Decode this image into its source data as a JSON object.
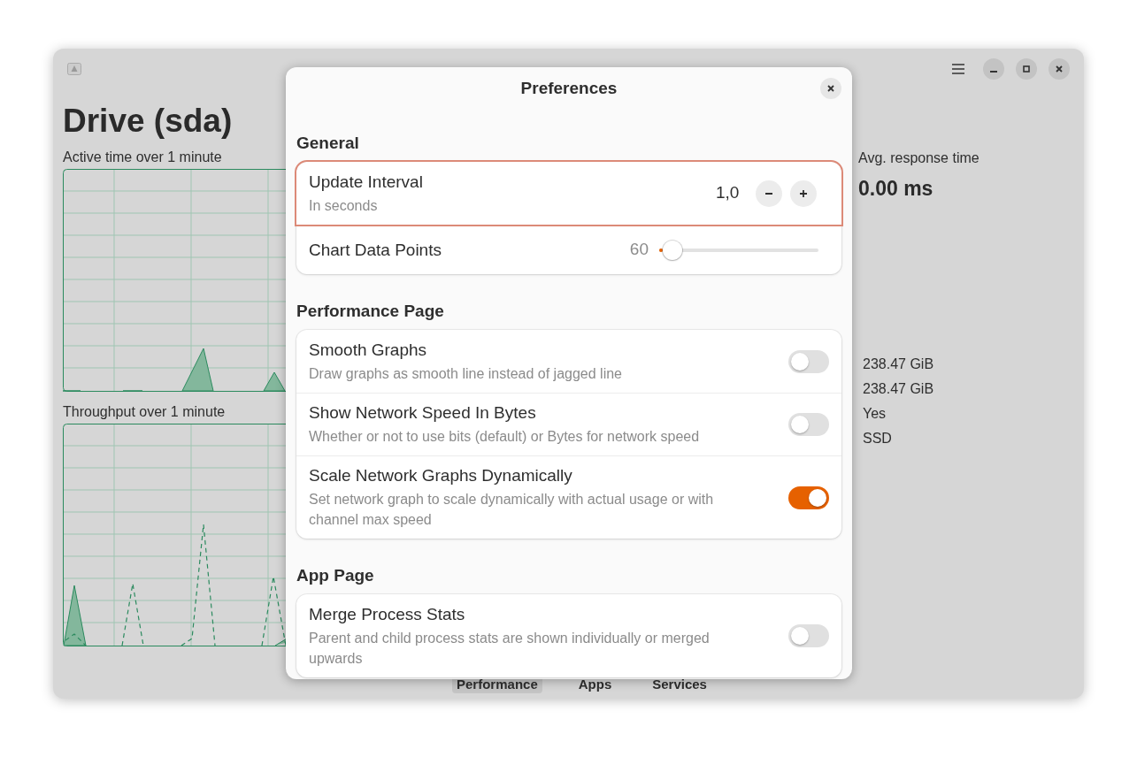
{
  "window": {
    "title": "Drive (sda)",
    "charts": [
      {
        "title": "Active time over 1 minute",
        "kind": "single"
      },
      {
        "title": "Throughput over 1 minute",
        "kind": "dual"
      }
    ],
    "stats": [
      {
        "label": "Avg. response time",
        "value": "0.00 ms"
      }
    ],
    "details": [
      "238.47 GiB",
      "238.47 GiB",
      "Yes",
      "SSD"
    ],
    "tabs": [
      {
        "label": "Performance",
        "selected": true
      },
      {
        "label": "Apps",
        "selected": false
      },
      {
        "label": "Services",
        "selected": false
      }
    ]
  },
  "dialog": {
    "title": "Preferences",
    "sections": [
      {
        "heading": "General",
        "rows": [
          {
            "kind": "spin",
            "title": "Update Interval",
            "subtitle": "In seconds",
            "value": "1,0",
            "focused": true
          },
          {
            "kind": "slider",
            "title": "Chart Data Points",
            "reading": "60",
            "level": 0.02
          }
        ]
      },
      {
        "heading": "Performance Page",
        "rows": [
          {
            "kind": "switch",
            "title": "Smooth Graphs",
            "subtitle": "Draw graphs as smooth line instead of jagged line",
            "on": false
          },
          {
            "kind": "switch",
            "title": "Show Network Speed In Bytes",
            "subtitle": "Whether or not to use bits (default) or Bytes for network speed",
            "on": false
          },
          {
            "kind": "switch",
            "title": "Scale Network Graphs Dynamically",
            "subtitle": "Set network graph to scale dynamically with actual usage or with channel max speed",
            "on": true
          }
        ]
      },
      {
        "heading": "App Page",
        "rows": [
          {
            "kind": "switch",
            "title": "Merge Process Stats",
            "subtitle": "Parent and child process stats are shown individually or merged upwards",
            "on": false
          }
        ]
      }
    ]
  }
}
